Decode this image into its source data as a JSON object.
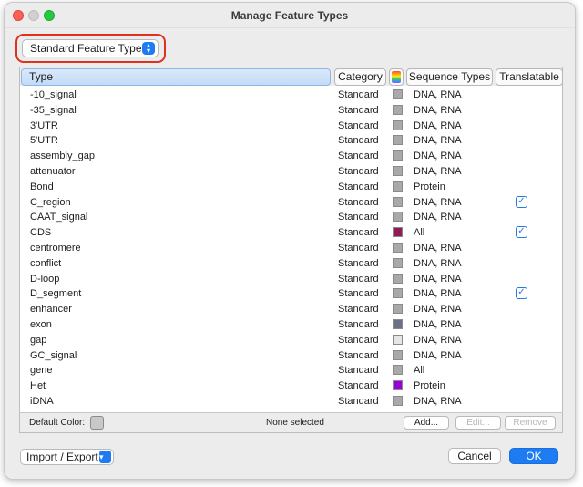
{
  "window": {
    "title": "Manage Feature Types"
  },
  "filter": {
    "selected": "Standard Feature Types"
  },
  "table": {
    "columns": [
      "Type",
      "Category",
      "Sequence Types",
      "Translatable"
    ],
    "rows": [
      {
        "type": "-10_signal",
        "category": "Standard",
        "color": "#a9a9a9",
        "seq": "DNA, RNA",
        "translatable": false
      },
      {
        "type": "-35_signal",
        "category": "Standard",
        "color": "#a9a9a9",
        "seq": "DNA, RNA",
        "translatable": false
      },
      {
        "type": "3'UTR",
        "category": "Standard",
        "color": "#a9a9a9",
        "seq": "DNA, RNA",
        "translatable": false
      },
      {
        "type": "5'UTR",
        "category": "Standard",
        "color": "#a9a9a9",
        "seq": "DNA, RNA",
        "translatable": false
      },
      {
        "type": "assembly_gap",
        "category": "Standard",
        "color": "#a9a9a9",
        "seq": "DNA, RNA",
        "translatable": false
      },
      {
        "type": "attenuator",
        "category": "Standard",
        "color": "#a9a9a9",
        "seq": "DNA, RNA",
        "translatable": false
      },
      {
        "type": "Bond",
        "category": "Standard",
        "color": "#a9a9a9",
        "seq": "Protein",
        "translatable": false
      },
      {
        "type": "C_region",
        "category": "Standard",
        "color": "#a9a9a9",
        "seq": "DNA, RNA",
        "translatable": true
      },
      {
        "type": "CAAT_signal",
        "category": "Standard",
        "color": "#a9a9a9",
        "seq": "DNA, RNA",
        "translatable": false
      },
      {
        "type": "CDS",
        "category": "Standard",
        "color": "#8f1d55",
        "seq": "All",
        "translatable": true
      },
      {
        "type": "centromere",
        "category": "Standard",
        "color": "#a9a9a9",
        "seq": "DNA, RNA",
        "translatable": false
      },
      {
        "type": "conflict",
        "category": "Standard",
        "color": "#a9a9a9",
        "seq": "DNA, RNA",
        "translatable": false
      },
      {
        "type": "D-loop",
        "category": "Standard",
        "color": "#a9a9a9",
        "seq": "DNA, RNA",
        "translatable": false
      },
      {
        "type": "D_segment",
        "category": "Standard",
        "color": "#a9a9a9",
        "seq": "DNA, RNA",
        "translatable": true
      },
      {
        "type": "enhancer",
        "category": "Standard",
        "color": "#a9a9a9",
        "seq": "DNA, RNA",
        "translatable": false
      },
      {
        "type": "exon",
        "category": "Standard",
        "color": "#6b7085",
        "seq": "DNA, RNA",
        "translatable": false
      },
      {
        "type": "gap",
        "category": "Standard",
        "color": "#e6e6e6",
        "seq": "DNA, RNA",
        "translatable": false
      },
      {
        "type": "GC_signal",
        "category": "Standard",
        "color": "#a9a9a9",
        "seq": "DNA, RNA",
        "translatable": false
      },
      {
        "type": "gene",
        "category": "Standard",
        "color": "#a9a9a9",
        "seq": "All",
        "translatable": false
      },
      {
        "type": "Het",
        "category": "Standard",
        "color": "#9a00d8",
        "seq": "Protein",
        "translatable": false
      },
      {
        "type": "iDNA",
        "category": "Standard",
        "color": "#a9a9a9",
        "seq": "DNA, RNA",
        "translatable": false
      }
    ]
  },
  "footer": {
    "default_color_label": "Default Color:",
    "selection_status": "None selected",
    "add_label": "Add...",
    "edit_label": "Edit...",
    "remove_label": "Remove"
  },
  "bottom": {
    "import_export_label": "Import / Export",
    "cancel_label": "Cancel",
    "ok_label": "OK"
  }
}
